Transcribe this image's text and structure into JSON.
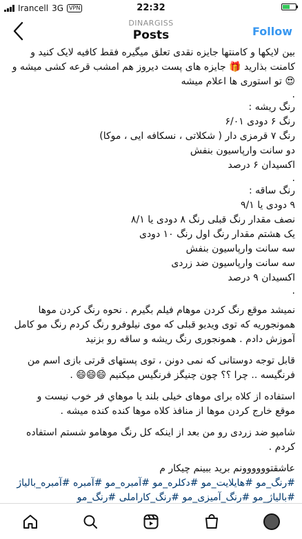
{
  "status_bar": {
    "carrier": "Irancell",
    "network": "3G",
    "vpn": "VPN",
    "time": "22:32",
    "battery_level": 0.55,
    "battery_color": "#34c759"
  },
  "header": {
    "username": "DINARGISS",
    "title": "Posts",
    "follow": "Follow",
    "follow_color": "#3897f0"
  },
  "caption": {
    "intro": [
      "بین لایکها و کامنتها جایزه نقدی تعلق میگیره فقط کافیه لایک کنید و",
      "کامنت بذارید 🎁 جایزه های پست دیروز هم امشب قرعه کشی میشه و",
      "😍 تو استوری ها اعلام میشه"
    ],
    "root_title": "رنگ ریشه :",
    "root_lines": [
      "رنگ ۶ دودی ۶/۰۱",
      "رنگ ۷ قرمزی دار ( شکلاتی ، نسکافه ایی ، موکا)",
      "دو سانت وارپاسیون بنفش",
      "اکسیدان ۶ درصد"
    ],
    "stem_title": "رنگ ساقه :",
    "stem_lines": [
      "۹ دودی یا ۹/۱",
      "نصف مقدار رنگ قبلی رنگ ۸ دودی یا ۸/۱",
      "یک هشتم مقدار رنگ اول رنگ ۱۰ دودی",
      "سه سانت وارپاسیون بنفش",
      "سه سانت وارپاسیون ضد زردی",
      "اکسیدان ۹ درصد"
    ],
    "para1": [
      "نمیشد موقع رنگ کردن موهام فیلم بگیرم . نحوه رنگ کردن موها",
      "همونجوریه که توی ویدیو قبلی که موی نیلوفرو رنگ کردم  رنگ مو کامل",
      "آموزش دادم . همونجوری رنگ ریشه و ساقه رو بزنید"
    ],
    "para2": [
      "قابل توجه دوستانی که نمی دونن ، توی پستهای قرتی بازی اسم من",
      "فرنگیسه .. چرا ؟؟ چون چنیگز فرنگیس میکنیم 😄😄😄 ."
    ],
    "para3": [
      "استفاده از کلاه برای موهای خیلی بلند یا موهاي فر خوب نیست و",
      "موقع خارج کردن موها از منافذ کلاه موها کنده کنده میشه ."
    ],
    "para4": [
      "شامپو ضد زردی رو من بعد از اینکه کل رنگ موهامو شستم استفاده",
      "کردم ."
    ],
    "closing": "عاشقتوووووونم برید ببینم چیکار م",
    "hashtags": [
      "#رنگ_مو #هایلایت_مو #دکلره_مو #آمبره_مو #آمبره #آمبره_بالیاژ",
      "#بالیاژ_مو #رنگ_آمیزی_مو #رنگ_کاراملی #رنگ_مو"
    ]
  },
  "nav": {
    "home": "home-icon",
    "search": "search-icon",
    "reels": "reels-icon",
    "shop": "shop-icon",
    "profile": "profile-avatar"
  }
}
